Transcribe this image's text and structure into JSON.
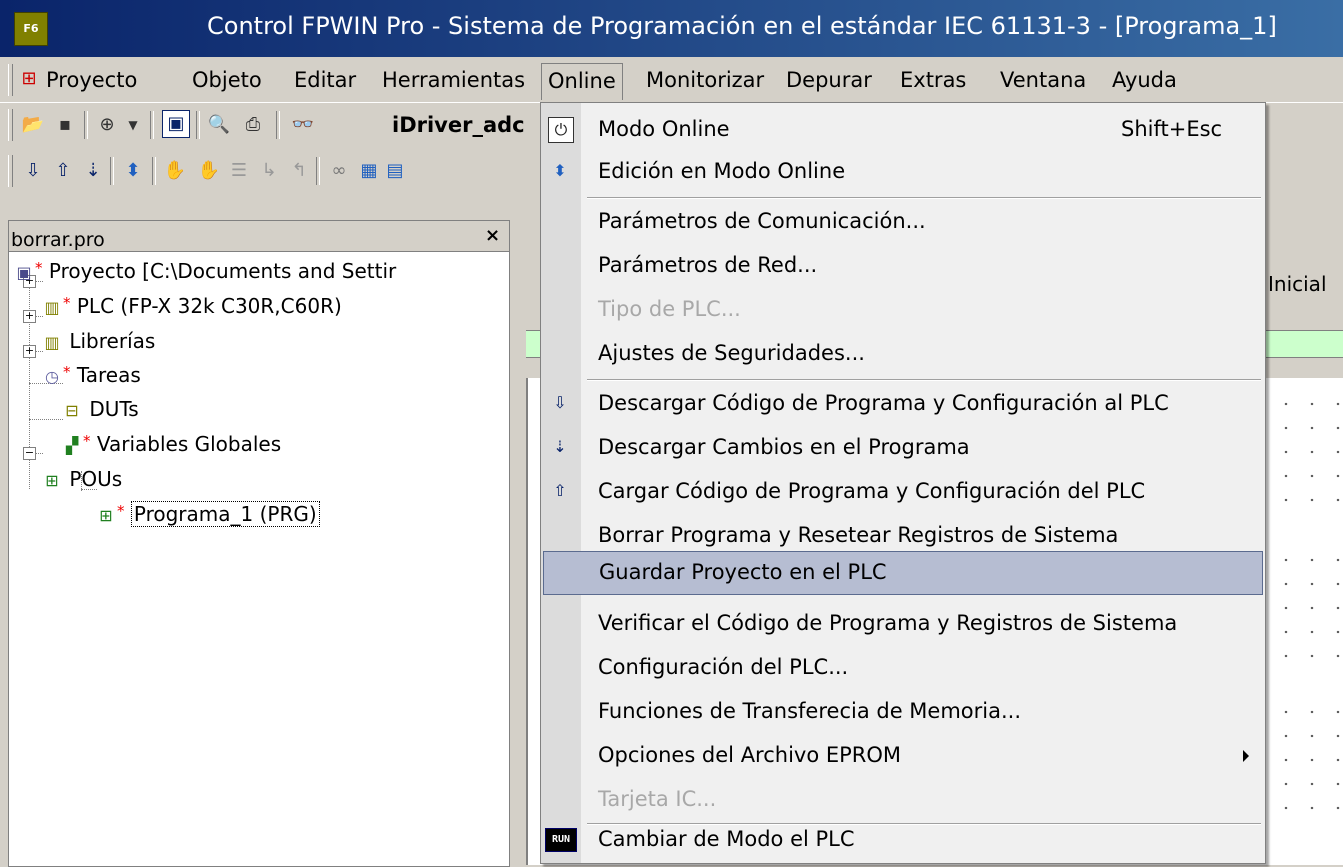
{
  "window": {
    "title": "Control FPWIN Pro - Sistema de Programación en el estándar IEC 61131-3 - [Programa_1]"
  },
  "menubar": {
    "items": [
      "Proyecto",
      "Objeto",
      "Editar",
      "Herramientas",
      "Online",
      "Monitorizar",
      "Depurar",
      "Extras",
      "Ventana",
      "Ayuda"
    ],
    "open": "Online"
  },
  "toolbar": {
    "driver_label": "iDriver_adc"
  },
  "project_panel": {
    "title": "borrar.pro",
    "tree": [
      {
        "label": "Proyecto [C:\\Documents and Settir",
        "icon": "project-icon",
        "modified": true
      },
      {
        "label": "PLC (FP-X 32k C30R,C60R)",
        "icon": "plc-icon",
        "modified": true
      },
      {
        "label": "Librerías",
        "icon": "library-icon",
        "modified": false
      },
      {
        "label": "Tareas",
        "icon": "tasks-icon",
        "modified": true
      },
      {
        "label": "DUTs",
        "icon": "duts-icon",
        "modified": false
      },
      {
        "label": "Variables Globales",
        "icon": "globals-icon",
        "modified": true
      },
      {
        "label": "POUs",
        "icon": "pous-icon",
        "modified": false
      },
      {
        "label": "Programa_1 (PRG)",
        "icon": "program-icon",
        "modified": true
      }
    ]
  },
  "editor": {
    "column_header": "Inicial"
  },
  "online_menu": {
    "items": [
      {
        "label": "Modo Online",
        "shortcut": "Shift+Esc",
        "icon": "online-mode-icon"
      },
      {
        "label": "Edición en Modo Online",
        "icon": "online-edit-icon"
      },
      {
        "label": "Parámetros de Comunicación..."
      },
      {
        "label": "Parámetros de Red..."
      },
      {
        "label": "Tipo de PLC...",
        "disabled": true
      },
      {
        "label": "Ajustes de Seguridades..."
      },
      {
        "label": "Descargar Código de Programa y Configuración al PLC",
        "icon": "download-icon"
      },
      {
        "label": "Descargar Cambios en el Programa",
        "icon": "download-changes-icon"
      },
      {
        "label": "Cargar Código de Programa y Configuración del PLC",
        "icon": "upload-icon"
      },
      {
        "label": "Borrar Programa y Resetear Registros de Sistema"
      },
      {
        "label": "Guardar Proyecto en el PLC",
        "selected": true
      },
      {
        "label": "Verificar el Código de Programa y Registros de Sistema"
      },
      {
        "label": "Configuración del PLC..."
      },
      {
        "label": "Funciones de Transferecia de Memoria..."
      },
      {
        "label": "Opciones del Archivo EPROM",
        "submenu": true
      },
      {
        "label": "Tarjeta IC...",
        "disabled": true
      },
      {
        "label": "Cambiar de Modo el PLC",
        "icon": "run-icon"
      }
    ],
    "run_icon_text": "RUN"
  }
}
